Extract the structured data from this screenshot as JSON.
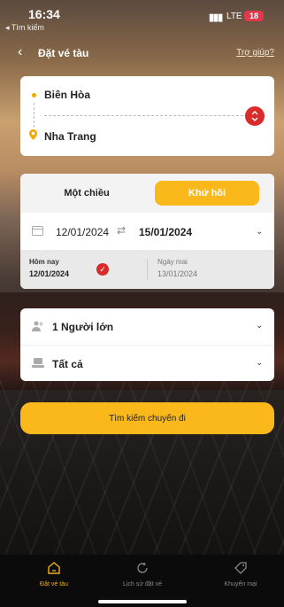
{
  "status_bar": {
    "time": "16:34",
    "back_app": "◂ Tìm kiếm",
    "network": "LTE",
    "battery": "18"
  },
  "header": {
    "title": "Đặt vé tàu",
    "help": "Trợ giúp?"
  },
  "route": {
    "from": "Biên Hòa",
    "to": "Nha Trang"
  },
  "trip": {
    "tabs": [
      "Một chiều",
      "Khứ hồi"
    ],
    "active_tab": "Khứ hồi",
    "depart_date": "12/01/2024",
    "arrows": "⇄",
    "return_date": "15/01/2024",
    "quick": [
      {
        "label": "Hôm nay",
        "date": "12/01/2024",
        "selected": true
      },
      {
        "label": "Ngày mai",
        "date": "13/01/2024",
        "selected": false
      }
    ]
  },
  "passengers": {
    "label": "1 Người lớn"
  },
  "seat_class": {
    "label": "Tất cả"
  },
  "search_button": "Tìm kiếm chuyến đi",
  "nav": [
    {
      "label": "Đặt vé tàu",
      "icon": "home-icon",
      "active": true
    },
    {
      "label": "Lịch sử đặt vé",
      "icon": "history-icon",
      "active": false
    },
    {
      "label": "Khuyến mại",
      "icon": "tag-icon",
      "active": false
    }
  ],
  "colors": {
    "accent": "#fbb81a",
    "danger": "#d92b2b",
    "active_nav": "#f2b01e"
  }
}
